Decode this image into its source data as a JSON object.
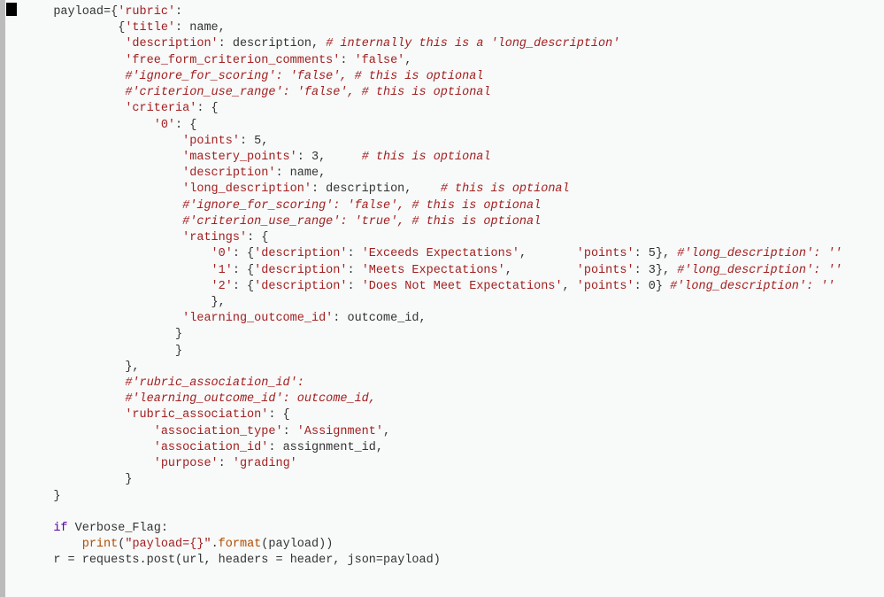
{
  "code": {
    "lines": [
      {
        "i": "   ",
        "t": [
          {
            "c": "tok-var",
            "s": "payload"
          },
          {
            "c": "tok-punc",
            "s": "={"
          },
          {
            "c": "tok-str",
            "s": "'rubric'"
          },
          {
            "c": "tok-punc",
            "s": ":"
          }
        ]
      },
      {
        "i": "            ",
        "t": [
          {
            "c": "tok-punc",
            "s": "{"
          },
          {
            "c": "tok-str",
            "s": "'title'"
          },
          {
            "c": "tok-punc",
            "s": ": "
          },
          {
            "c": "tok-var",
            "s": "name"
          },
          {
            "c": "tok-punc",
            "s": ","
          }
        ]
      },
      {
        "i": "             ",
        "t": [
          {
            "c": "tok-str",
            "s": "'description'"
          },
          {
            "c": "tok-punc",
            "s": ": "
          },
          {
            "c": "tok-var",
            "s": "description"
          },
          {
            "c": "tok-punc",
            "s": ", "
          },
          {
            "c": "tok-cm",
            "s": "# internally this is a 'long_description'"
          }
        ]
      },
      {
        "i": "             ",
        "t": [
          {
            "c": "tok-str",
            "s": "'free_form_criterion_comments'"
          },
          {
            "c": "tok-punc",
            "s": ": "
          },
          {
            "c": "tok-str",
            "s": "'false'"
          },
          {
            "c": "tok-punc",
            "s": ","
          }
        ]
      },
      {
        "i": "             ",
        "t": [
          {
            "c": "tok-cm",
            "s": "#'ignore_for_scoring': 'false', # this is optional"
          }
        ]
      },
      {
        "i": "             ",
        "t": [
          {
            "c": "tok-cm",
            "s": "#'criterion_use_range': 'false', # this is optional"
          }
        ]
      },
      {
        "i": "             ",
        "t": [
          {
            "c": "tok-str",
            "s": "'criteria'"
          },
          {
            "c": "tok-punc",
            "s": ": {"
          }
        ]
      },
      {
        "i": "                 ",
        "t": [
          {
            "c": "tok-str",
            "s": "'0'"
          },
          {
            "c": "tok-punc",
            "s": ": {"
          }
        ]
      },
      {
        "i": "                     ",
        "t": [
          {
            "c": "tok-str",
            "s": "'points'"
          },
          {
            "c": "tok-punc",
            "s": ": "
          },
          {
            "c": "tok-num",
            "s": "5"
          },
          {
            "c": "tok-punc",
            "s": ","
          }
        ]
      },
      {
        "i": "                     ",
        "t": [
          {
            "c": "tok-str",
            "s": "'mastery_points'"
          },
          {
            "c": "tok-punc",
            "s": ": "
          },
          {
            "c": "tok-num",
            "s": "3"
          },
          {
            "c": "tok-punc",
            "s": ",     "
          },
          {
            "c": "tok-cm",
            "s": "# this is optional"
          }
        ]
      },
      {
        "i": "                     ",
        "t": [
          {
            "c": "tok-str",
            "s": "'description'"
          },
          {
            "c": "tok-punc",
            "s": ": "
          },
          {
            "c": "tok-var",
            "s": "name"
          },
          {
            "c": "tok-punc",
            "s": ","
          }
        ]
      },
      {
        "i": "                     ",
        "t": [
          {
            "c": "tok-str",
            "s": "'long_description'"
          },
          {
            "c": "tok-punc",
            "s": ": "
          },
          {
            "c": "tok-var",
            "s": "description"
          },
          {
            "c": "tok-punc",
            "s": ",    "
          },
          {
            "c": "tok-cm",
            "s": "# this is optional"
          }
        ]
      },
      {
        "i": "                     ",
        "t": [
          {
            "c": "tok-cm",
            "s": "#'ignore_for_scoring': 'false', # this is optional"
          }
        ]
      },
      {
        "i": "                     ",
        "t": [
          {
            "c": "tok-cm",
            "s": "#'criterion_use_range': 'true', # this is optional"
          }
        ]
      },
      {
        "i": "                     ",
        "t": [
          {
            "c": "tok-str",
            "s": "'ratings'"
          },
          {
            "c": "tok-punc",
            "s": ": {"
          }
        ]
      },
      {
        "i": "                         ",
        "t": [
          {
            "c": "tok-str",
            "s": "'0'"
          },
          {
            "c": "tok-punc",
            "s": ": {"
          },
          {
            "c": "tok-str",
            "s": "'description'"
          },
          {
            "c": "tok-punc",
            "s": ": "
          },
          {
            "c": "tok-str",
            "s": "'Exceeds Expectations'"
          },
          {
            "c": "tok-punc",
            "s": ",       "
          },
          {
            "c": "tok-str",
            "s": "'points'"
          },
          {
            "c": "tok-punc",
            "s": ": "
          },
          {
            "c": "tok-num",
            "s": "5"
          },
          {
            "c": "tok-punc",
            "s": "}, "
          },
          {
            "c": "tok-cm",
            "s": "#'long_description': ''"
          }
        ]
      },
      {
        "i": "                         ",
        "t": [
          {
            "c": "tok-str",
            "s": "'1'"
          },
          {
            "c": "tok-punc",
            "s": ": {"
          },
          {
            "c": "tok-str",
            "s": "'description'"
          },
          {
            "c": "tok-punc",
            "s": ": "
          },
          {
            "c": "tok-str",
            "s": "'Meets Expectations'"
          },
          {
            "c": "tok-punc",
            "s": ",         "
          },
          {
            "c": "tok-str",
            "s": "'points'"
          },
          {
            "c": "tok-punc",
            "s": ": "
          },
          {
            "c": "tok-num",
            "s": "3"
          },
          {
            "c": "tok-punc",
            "s": "}, "
          },
          {
            "c": "tok-cm",
            "s": "#'long_description': ''"
          }
        ]
      },
      {
        "i": "                         ",
        "t": [
          {
            "c": "tok-str",
            "s": "'2'"
          },
          {
            "c": "tok-punc",
            "s": ": {"
          },
          {
            "c": "tok-str",
            "s": "'description'"
          },
          {
            "c": "tok-punc",
            "s": ": "
          },
          {
            "c": "tok-str",
            "s": "'Does Not Meet Expectations'"
          },
          {
            "c": "tok-punc",
            "s": ", "
          },
          {
            "c": "tok-str",
            "s": "'points'"
          },
          {
            "c": "tok-punc",
            "s": ": "
          },
          {
            "c": "tok-num",
            "s": "0"
          },
          {
            "c": "tok-punc",
            "s": "} "
          },
          {
            "c": "tok-cm",
            "s": "#'long_description': ''"
          }
        ]
      },
      {
        "i": "                         ",
        "t": [
          {
            "c": "tok-punc",
            "s": "},"
          }
        ]
      },
      {
        "i": "                     ",
        "t": [
          {
            "c": "tok-str",
            "s": "'learning_outcome_id'"
          },
          {
            "c": "tok-punc",
            "s": ": "
          },
          {
            "c": "tok-var",
            "s": "outcome_id"
          },
          {
            "c": "tok-punc",
            "s": ","
          }
        ]
      },
      {
        "i": "                    ",
        "t": [
          {
            "c": "tok-punc",
            "s": "}"
          }
        ]
      },
      {
        "i": "                    ",
        "t": [
          {
            "c": "tok-punc",
            "s": "}"
          }
        ]
      },
      {
        "i": "             ",
        "t": [
          {
            "c": "tok-punc",
            "s": "},"
          }
        ]
      },
      {
        "i": "             ",
        "t": [
          {
            "c": "tok-cm",
            "s": "#'rubric_association_id':"
          }
        ]
      },
      {
        "i": "             ",
        "t": [
          {
            "c": "tok-cm",
            "s": "#'learning_outcome_id': outcome_id,"
          }
        ]
      },
      {
        "i": "             ",
        "t": [
          {
            "c": "tok-str",
            "s": "'rubric_association'"
          },
          {
            "c": "tok-punc",
            "s": ": {"
          }
        ]
      },
      {
        "i": "                 ",
        "t": [
          {
            "c": "tok-str",
            "s": "'association_type'"
          },
          {
            "c": "tok-punc",
            "s": ": "
          },
          {
            "c": "tok-str",
            "s": "'Assignment'"
          },
          {
            "c": "tok-punc",
            "s": ","
          }
        ]
      },
      {
        "i": "                 ",
        "t": [
          {
            "c": "tok-str",
            "s": "'association_id'"
          },
          {
            "c": "tok-punc",
            "s": ": "
          },
          {
            "c": "tok-var",
            "s": "assignment_id"
          },
          {
            "c": "tok-punc",
            "s": ","
          }
        ]
      },
      {
        "i": "                 ",
        "t": [
          {
            "c": "tok-str",
            "s": "'purpose'"
          },
          {
            "c": "tok-punc",
            "s": ": "
          },
          {
            "c": "tok-str",
            "s": "'grading'"
          }
        ]
      },
      {
        "i": "             ",
        "t": [
          {
            "c": "tok-punc",
            "s": "}"
          }
        ]
      },
      {
        "i": "   ",
        "t": [
          {
            "c": "tok-punc",
            "s": "}"
          }
        ]
      },
      {
        "i": "",
        "t": [
          {
            "c": "",
            "s": " "
          }
        ]
      },
      {
        "i": "   ",
        "t": [
          {
            "c": "tok-kw",
            "s": "if"
          },
          {
            "c": "tok-punc",
            "s": " "
          },
          {
            "c": "tok-var",
            "s": "Verbose_Flag"
          },
          {
            "c": "tok-punc",
            "s": ":"
          }
        ]
      },
      {
        "i": "       ",
        "t": [
          {
            "c": "tok-fn",
            "s": "print"
          },
          {
            "c": "tok-punc",
            "s": "("
          },
          {
            "c": "tok-str",
            "s": "\"payload={}\""
          },
          {
            "c": "tok-punc",
            "s": "."
          },
          {
            "c": "tok-fn",
            "s": "format"
          },
          {
            "c": "tok-punc",
            "s": "("
          },
          {
            "c": "tok-var",
            "s": "payload"
          },
          {
            "c": "tok-punc",
            "s": "))"
          }
        ]
      },
      {
        "i": "   ",
        "t": [
          {
            "c": "tok-var",
            "s": "r "
          },
          {
            "c": "tok-punc",
            "s": "= "
          },
          {
            "c": "tok-var",
            "s": "requests"
          },
          {
            "c": "tok-punc",
            "s": "."
          },
          {
            "c": "tok-var",
            "s": "post"
          },
          {
            "c": "tok-punc",
            "s": "("
          },
          {
            "c": "tok-var",
            "s": "url"
          },
          {
            "c": "tok-punc",
            "s": ", "
          },
          {
            "c": "tok-var",
            "s": "headers "
          },
          {
            "c": "tok-punc",
            "s": "= "
          },
          {
            "c": "tok-var",
            "s": "header"
          },
          {
            "c": "tok-punc",
            "s": ", "
          },
          {
            "c": "tok-var",
            "s": "json"
          },
          {
            "c": "tok-punc",
            "s": "="
          },
          {
            "c": "tok-var",
            "s": "payload"
          },
          {
            "c": "tok-punc",
            "s": ")"
          }
        ]
      }
    ]
  }
}
